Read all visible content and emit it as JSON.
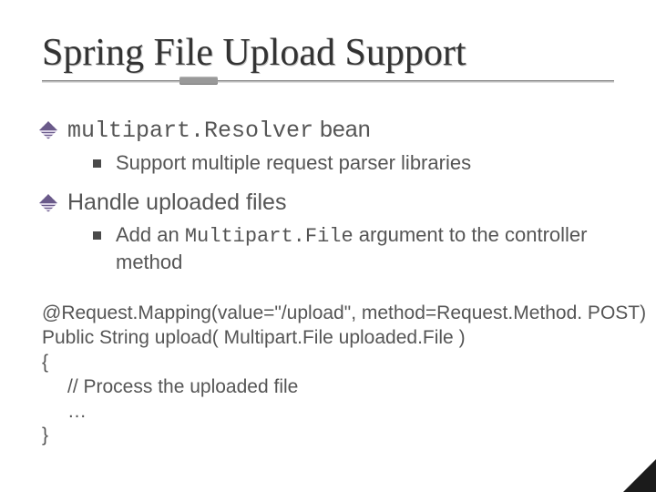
{
  "title": "Spring File Upload Support",
  "bullets": {
    "b1a_code": "multipart.Resolver",
    "b1a_rest": " bean",
    "b2a": "Support multiple request parser libraries",
    "b1b": "Handle uploaded files",
    "b2b_pre": "Add an ",
    "b2b_code": "Multipart.File",
    "b2b_post": " argument to the controller method"
  },
  "code": {
    "l1": "@Request.Mapping(value=\"/upload\", method=Request.Method. POST)",
    "l2": "Public String upload( Multipart.File uploaded.File )",
    "l3": "{",
    "l4": "// Process the uploaded file",
    "l5": "…",
    "l6": "}"
  }
}
